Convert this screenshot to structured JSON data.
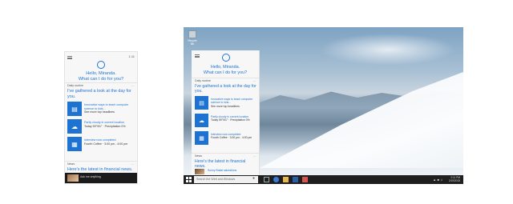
{
  "phone": {
    "time": "1:11",
    "greeting_line1": "Hello, Miranda.",
    "greeting_line2": "What can I do for you?",
    "section_daily": "Daily routine",
    "dots": "...",
    "headline": "I've gathered a look at the day for you.",
    "items": [
      {
        "icon": "news-icon",
        "title": "Innovative ways to teach computer science to kids...",
        "sub": "See more top headlines"
      },
      {
        "icon": "weather-icon",
        "title": "Partly cloudy in current location",
        "sub": "Today 59°/51° · Precipitation 0%"
      },
      {
        "icon": "calendar-icon",
        "title": "Interview now completed",
        "sub": "Fourth Coffee · 3:00 pm - 4:00 pm"
      }
    ],
    "section_news": "News",
    "news_headline": "Here's the latest in financial news.",
    "taskbar_text": "Ask me anything"
  },
  "desktop": {
    "desktop_icon_label": "Recycle Bin",
    "greeting_line1": "Hello, Miranda.",
    "greeting_line2": "What can I do for you?",
    "section_daily": "Daily routine",
    "dots": "...",
    "headline": "I've gathered a look at the day for you.",
    "items": [
      {
        "icon": "news-icon",
        "title": "Innovative ways to teach computer science to kids...",
        "sub": "See more top headlines"
      },
      {
        "icon": "weather-icon",
        "title": "Partly cloudy in current location",
        "sub": "Today 59°/51° · Precipitation 0%"
      },
      {
        "icon": "calendar-icon",
        "title": "Interview now completed",
        "sub": "Fourth Coffee · 3:00 pm - 4:00 pm"
      }
    ],
    "section_news": "News",
    "news_headline": "Here's the latest in financial news.",
    "news_item": "Sunny Bakal salutations",
    "search_placeholder": "Search the Web and Windows",
    "clock_time": "2:11 PM",
    "clock_date": "2/19/2015"
  },
  "colors": {
    "accent": "#1e73d2",
    "taskbar": "#1f1f1f",
    "panel": "#f7f7f7"
  }
}
